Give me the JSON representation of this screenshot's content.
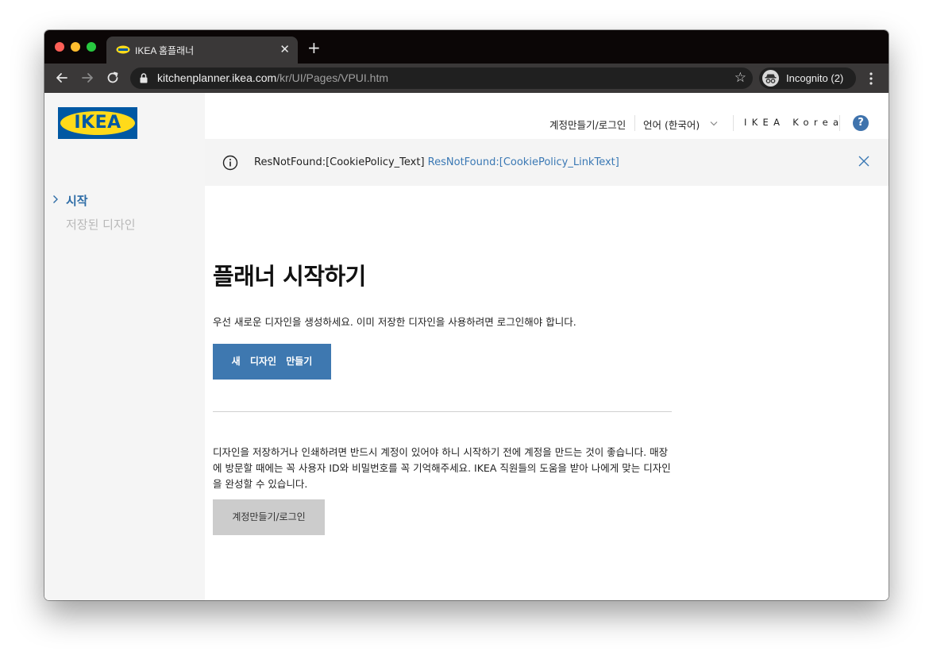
{
  "browser": {
    "tab": {
      "title": "IKEA 홈플래너",
      "close_glyph": "✕"
    },
    "new_tab_glyph": "+",
    "url": {
      "host": "kitchenplanner.ikea.com",
      "path": "/kr/UI/Pages/VPUI.htm"
    },
    "incognito_label": "Incognito (2)"
  },
  "logo": {
    "text": "IKEA",
    "registered": "®"
  },
  "sidebar": {
    "items": [
      {
        "label": "시작",
        "active": true
      },
      {
        "label": "저장된 디자인",
        "active": false
      }
    ]
  },
  "header": {
    "account_link": "계정만들기/로그인",
    "language": "언어 (한국어)",
    "store": "IKEA Korea",
    "help": "?"
  },
  "banner": {
    "text": "ResNotFound:[CookiePolicy_Text]",
    "link": "ResNotFound:[CookiePolicy_LinkText]"
  },
  "main": {
    "title": "플래너 시작하기",
    "intro": "우선 새로운 디자인을 생성하세요. 이미 저장한 디자인을 사용하려면 로그인해야 합니다.",
    "new_design_button": "새 디자인 만들기",
    "paragraph": "디자인을 저장하거나 인쇄하려면 반드시 계정이 있어야 하니 시작하기 전에 계정을 만드는 것이 좋습니다. 매장에 방문할 때에는 꼭 사용자 ID와 비밀번호를 꼭 기억해주세요. IKEA 직원들의 도움을 받아 나에게 맞는 디자인을 완성할 수 있습니다.",
    "login_button": "계정만들기/로그인"
  },
  "colors": {
    "accent": "#3e78b0",
    "brand_blue": "#0058a3",
    "brand_yellow": "#ffda1a"
  }
}
